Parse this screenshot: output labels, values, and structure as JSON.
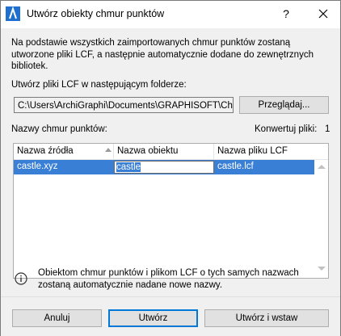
{
  "window": {
    "title": "Utwórz obiekty chmur punktów",
    "help_label": "?"
  },
  "intro_text": "Na podstawie wszystkich zaimportowanych chmur punktów zostaną utworzone pliki LCF, a następnie automatycznie dodane do zewnętrznych bibliotek.",
  "folder": {
    "label": "Utwórz pliki LCF w następującym folderze:",
    "path_value": "C:\\Users\\ArchiGraphi\\Documents\\GRAPHISOFT\\Chmury",
    "browse_label": "Przeglądaj..."
  },
  "list": {
    "label": "Nazwy chmur punktów:",
    "convert_label": "Konwertuj pliki:",
    "convert_count": "1",
    "columns": [
      "Nazwa źródła",
      "Nazwa obiektu",
      "Nazwa pliku LCF"
    ],
    "rows": [
      {
        "source": "castle.xyz",
        "object": "castle",
        "lcf": "castle.lcf"
      }
    ]
  },
  "info_text": "Obiektom chmur punktów i plikom LCF o tych samych nazwach zostaną automatycznie nadane nowe nazwy.",
  "buttons": {
    "cancel": "Anuluj",
    "create": "Utwórz",
    "create_insert": "Utwórz i wstaw"
  },
  "colors": {
    "selection": "#3a7fd6",
    "default_button_border": "#0078d7",
    "app_icon": "#1f6fd0"
  },
  "icons": {
    "app": "archicad-logo-icon",
    "close": "close-icon",
    "info": "info-icon",
    "sort": "sort-ascending-icon"
  }
}
